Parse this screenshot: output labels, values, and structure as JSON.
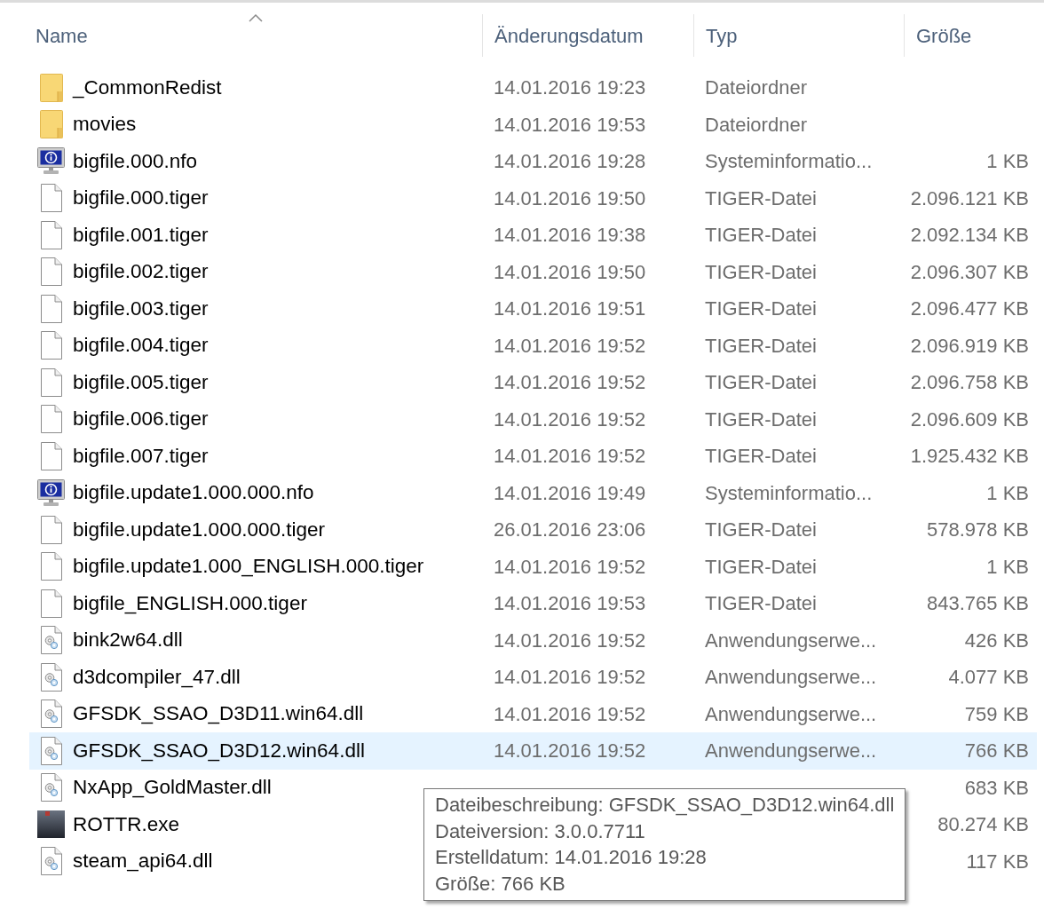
{
  "columns": [
    {
      "label": "Name",
      "sorted": true
    },
    {
      "label": "Änderungsdatum",
      "sorted": false
    },
    {
      "label": "Typ",
      "sorted": false
    },
    {
      "label": "Größe",
      "sorted": false
    }
  ],
  "rows": [
    {
      "kind": "folder",
      "name": "_CommonRedist",
      "modified": "14.01.2016 19:23",
      "type": "Dateiordner",
      "selected": false
    },
    {
      "kind": "folder",
      "name": "movies",
      "modified": "14.01.2016 19:53",
      "type": "Dateiordner",
      "selected": false
    },
    {
      "kind": "info",
      "name": "bigfile.000.nfo",
      "modified": "14.01.2016 19:28",
      "type": "Systeminformatio...",
      "size": "1 KB",
      "selected": false
    },
    {
      "kind": "file",
      "name": "bigfile.000.tiger",
      "modified": "14.01.2016 19:50",
      "type": "TIGER-Datei",
      "size": "2.096.121 KB",
      "selected": false
    },
    {
      "kind": "file",
      "name": "bigfile.001.tiger",
      "modified": "14.01.2016 19:38",
      "type": "TIGER-Datei",
      "size": "2.092.134 KB",
      "selected": false
    },
    {
      "kind": "file",
      "name": "bigfile.002.tiger",
      "modified": "14.01.2016 19:50",
      "type": "TIGER-Datei",
      "size": "2.096.307 KB",
      "selected": false
    },
    {
      "kind": "file",
      "name": "bigfile.003.tiger",
      "modified": "14.01.2016 19:51",
      "type": "TIGER-Datei",
      "size": "2.096.477 KB",
      "selected": false
    },
    {
      "kind": "file",
      "name": "bigfile.004.tiger",
      "modified": "14.01.2016 19:52",
      "type": "TIGER-Datei",
      "size": "2.096.919 KB",
      "selected": false
    },
    {
      "kind": "file",
      "name": "bigfile.005.tiger",
      "modified": "14.01.2016 19:52",
      "type": "TIGER-Datei",
      "size": "2.096.758 KB",
      "selected": false
    },
    {
      "kind": "file",
      "name": "bigfile.006.tiger",
      "modified": "14.01.2016 19:52",
      "type": "TIGER-Datei",
      "size": "2.096.609 KB",
      "selected": false
    },
    {
      "kind": "file",
      "name": "bigfile.007.tiger",
      "modified": "14.01.2016 19:52",
      "type": "TIGER-Datei",
      "size": "1.925.432 KB",
      "selected": false
    },
    {
      "kind": "info",
      "name": "bigfile.update1.000.000.nfo",
      "modified": "14.01.2016 19:49",
      "type": "Systeminformatio...",
      "size": "1 KB",
      "selected": false
    },
    {
      "kind": "file",
      "name": "bigfile.update1.000.000.tiger",
      "modified": "26.01.2016 23:06",
      "type": "TIGER-Datei",
      "size": "578.978 KB",
      "selected": false
    },
    {
      "kind": "file",
      "name": "bigfile.update1.000_ENGLISH.000.tiger",
      "modified": "14.01.2016 19:52",
      "type": "TIGER-Datei",
      "size": "1 KB",
      "selected": false
    },
    {
      "kind": "file",
      "name": "bigfile_ENGLISH.000.tiger",
      "modified": "14.01.2016 19:53",
      "type": "TIGER-Datei",
      "size": "843.765 KB",
      "selected": false
    },
    {
      "kind": "dll",
      "name": "bink2w64.dll",
      "modified": "14.01.2016 19:52",
      "type": "Anwendungserwe...",
      "size": "426 KB",
      "selected": false
    },
    {
      "kind": "dll",
      "name": "d3dcompiler_47.dll",
      "modified": "14.01.2016 19:52",
      "type": "Anwendungserwe...",
      "size": "4.077 KB",
      "selected": false
    },
    {
      "kind": "dll",
      "name": "GFSDK_SSAO_D3D11.win64.dll",
      "modified": "14.01.2016 19:52",
      "type": "Anwendungserwe...",
      "size": "759 KB",
      "selected": false
    },
    {
      "kind": "dll",
      "name": "GFSDK_SSAO_D3D12.win64.dll",
      "modified": "14.01.2016 19:52",
      "type": "Anwendungserwe...",
      "size": "766 KB",
      "selected": true
    },
    {
      "kind": "dll",
      "name": "NxApp_GoldMaster.dll",
      "size": "683 KB",
      "selected": false
    },
    {
      "kind": "exe",
      "name": "ROTTR.exe",
      "size": "80.274 KB",
      "selected": false
    },
    {
      "kind": "dll",
      "name": "steam_api64.dll",
      "size": "117 KB",
      "selected": false
    }
  ],
  "tooltip": {
    "lines": [
      "Dateibeschreibung: GFSDK_SSAO_D3D12.win64.dll",
      "Dateiversion: 3.0.0.7711",
      "Erstelldatum: 14.01.2016 19:28",
      "Größe: 766 KB"
    ]
  }
}
